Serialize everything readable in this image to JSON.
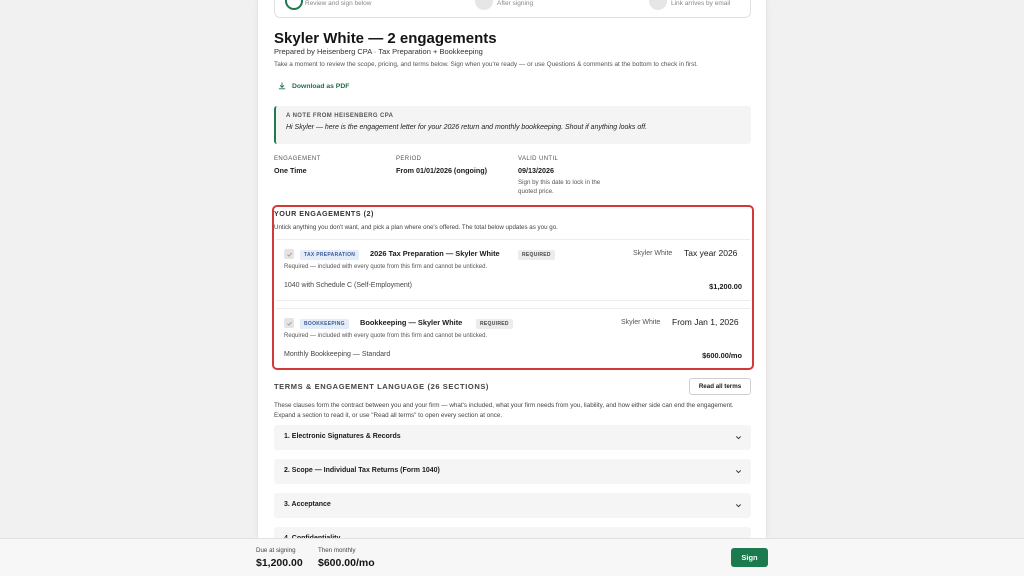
{
  "steps": [
    {
      "label": "Review and sign below"
    },
    {
      "label": "After signing"
    },
    {
      "label": "Link arrives by email"
    }
  ],
  "header": {
    "title": "Skyler White — 2 engagements",
    "prepared_by": "Prepared by Heisenberg CPA · Tax Preparation + Bookkeeping",
    "intro": "Take a moment to review the scope, pricing, and terms below. Sign when you're ready — or use Questions & comments at the bottom to check in first.",
    "download_label": "Download as PDF"
  },
  "note": {
    "label": "A NOTE FROM HEISENBERG CPA",
    "text": "Hi Skyler — here is the engagement letter for your 2026 return and monthly bookkeeping. Shout if anything looks off."
  },
  "meta": {
    "engagement": {
      "label": "ENGAGEMENT",
      "value": "One Time"
    },
    "period": {
      "label": "PERIOD",
      "value": "From 01/01/2026 (ongoing)"
    },
    "valid_until": {
      "label": "VALID UNTIL",
      "value": "09/13/2026",
      "sub": "Sign by this date to lock in the quoted price."
    }
  },
  "engagements": {
    "heading": "YOUR ENGAGEMENTS (2)",
    "subtext": "Untick anything you don't want, and pick a plan where one's offered. The total below updates as you go.",
    "items": [
      {
        "tag": "TAX PREPARATION",
        "name": "2026 Tax Preparation — Skyler White",
        "required": "REQUIRED",
        "client": "Skyler White",
        "when": "Tax year 2026",
        "note": "Required — included with every quote from this firm and cannot be unticked.",
        "line": "1040 with Schedule C (Self-Employment)",
        "price": "$1,200.00"
      },
      {
        "tag": "BOOKKEEPING",
        "name": "Bookkeeping — Skyler White",
        "required": "REQUIRED",
        "client": "Skyler White",
        "when": "From Jan 1, 2026",
        "note": "Required — included with every quote from this firm and cannot be unticked.",
        "line": "Monthly Bookkeeping — Standard",
        "price": "$600.00/mo"
      }
    ]
  },
  "terms": {
    "heading": "TERMS & ENGAGEMENT LANGUAGE (26 SECTIONS)",
    "read_all": "Read all terms",
    "description": "These clauses form the contract between you and your firm — what's included, what your firm needs from you, liability, and how either side can end the engagement. Expand a section to read it, or use \"Read all terms\" to open every section at once.",
    "sections": [
      "1. Electronic Signatures & Records",
      "2. Scope — Individual Tax Returns (Form 1040)",
      "3. Acceptance",
      "4. Confidentiality"
    ]
  },
  "footer": {
    "due_label": "Due at signing",
    "due_value": "$1,200.00",
    "monthly_label": "Then monthly",
    "monthly_value": "$600.00/mo",
    "sign_label": "Sign"
  },
  "colors": {
    "accent_green": "#1c7a4f",
    "highlight_red": "#d23a3a",
    "tag_blue_bg": "#e4ecf8"
  }
}
